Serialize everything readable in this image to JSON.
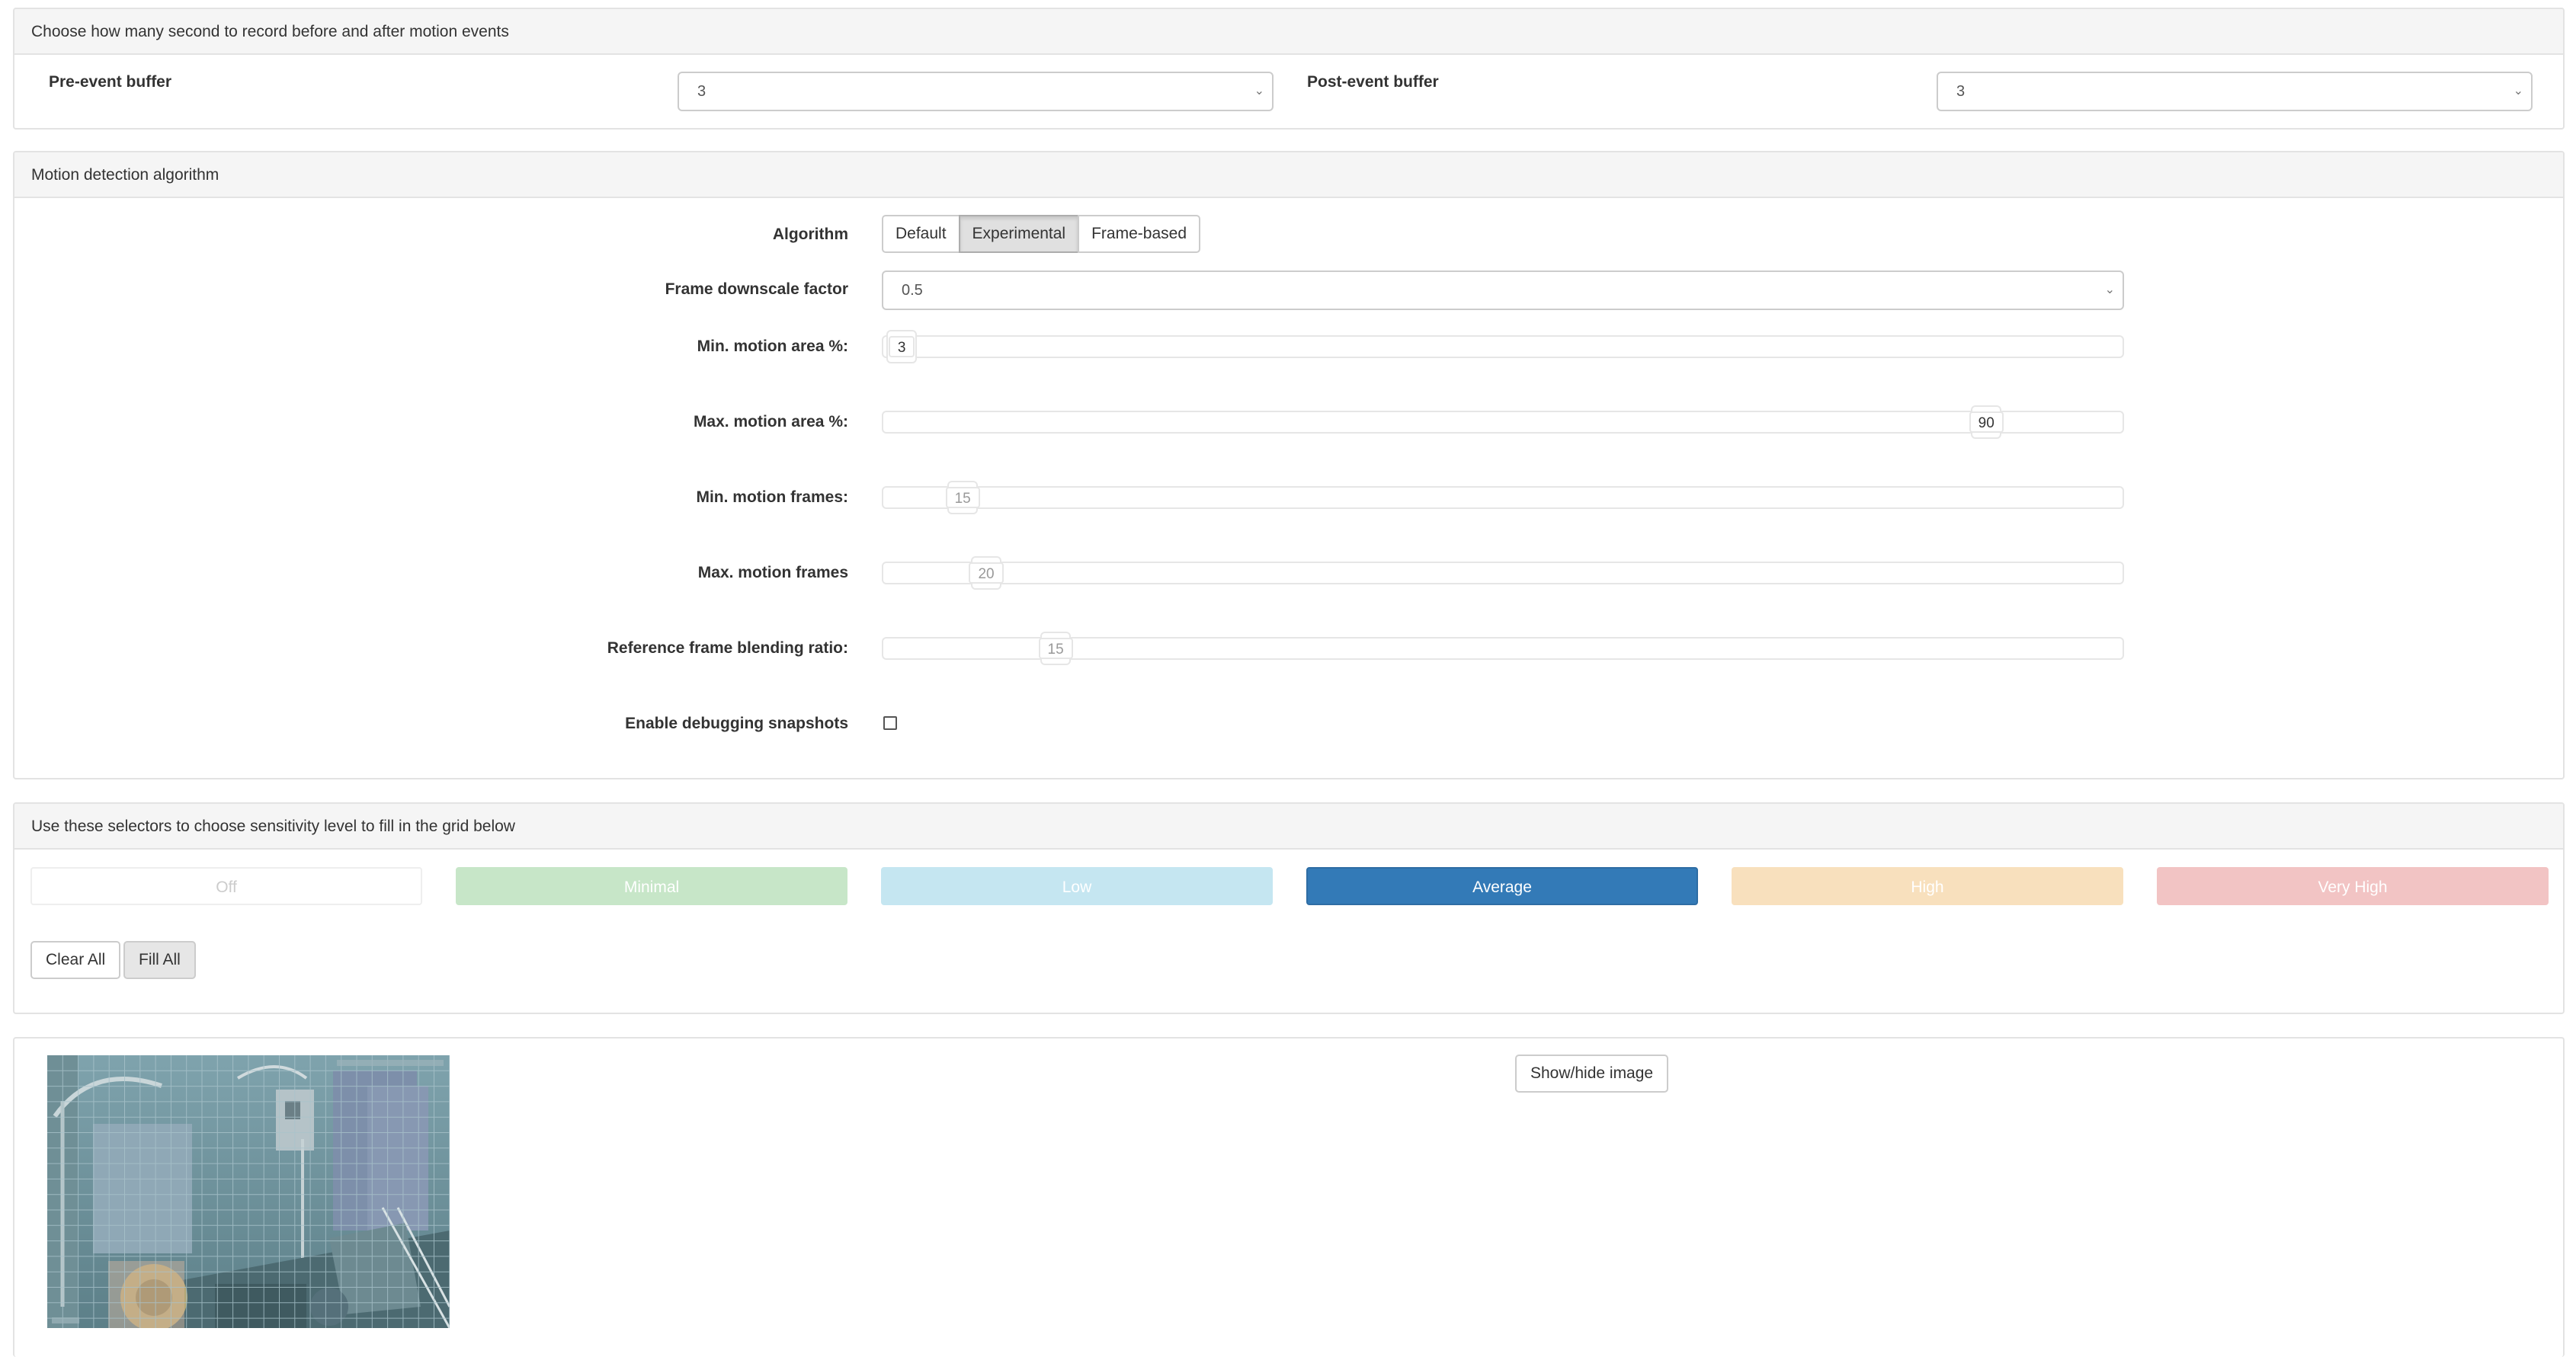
{
  "buffers": {
    "heading": "Choose how many second to record before and after motion events",
    "pre_label": "Pre-event buffer",
    "pre_value": "3",
    "post_label": "Post-event buffer",
    "post_value": "3"
  },
  "motion": {
    "heading": "Motion detection algorithm",
    "algorithm_label": "Algorithm",
    "algorithm_options": [
      "Default",
      "Experimental",
      "Frame-based"
    ],
    "algorithm_selected": "Experimental",
    "downscale_label": "Frame downscale factor",
    "downscale_value": "0.5",
    "sliders": [
      {
        "label": "Min. motion area %:",
        "value": "3",
        "fraction": 0.015
      },
      {
        "label": "Max. motion area %:",
        "value": "90",
        "fraction": 0.89
      },
      {
        "label": "Min. motion frames:",
        "value": "15",
        "fraction": 0.064
      },
      {
        "label": "Max. motion frames",
        "value": "20",
        "fraction": 0.083
      },
      {
        "label": "Reference frame blending ratio:",
        "value": "15",
        "fraction": 0.139
      }
    ],
    "debug_label": "Enable debugging snapshots",
    "debug_checked": false
  },
  "sensitivity": {
    "heading": "Use these selectors to choose sensitivity level to fill in the grid below",
    "levels": [
      {
        "label": "Off",
        "bg": "#ffffff",
        "fg": "#cccccc",
        "border": "#eeeeee"
      },
      {
        "label": "Minimal",
        "bg": "#c7e6c8",
        "fg": "#ffffff",
        "border": "#c7e6c8"
      },
      {
        "label": "Low",
        "bg": "#c5e6f1",
        "fg": "#ffffff",
        "border": "#c5e6f1"
      },
      {
        "label": "Average",
        "bg": "#337ab7",
        "fg": "#ffffff",
        "border": "#2e6da4"
      },
      {
        "label": "High",
        "bg": "#f8e0bd",
        "fg": "#ffffff",
        "border": "#f8e0bd"
      },
      {
        "label": "Very High",
        "bg": "#f2c4c4",
        "fg": "#ffffff",
        "border": "#f2c4c4"
      }
    ],
    "selected": "Average",
    "clear_label": "Clear All",
    "fill_label": "Fill All"
  },
  "image": {
    "show_hide_label": "Show/hide image"
  }
}
